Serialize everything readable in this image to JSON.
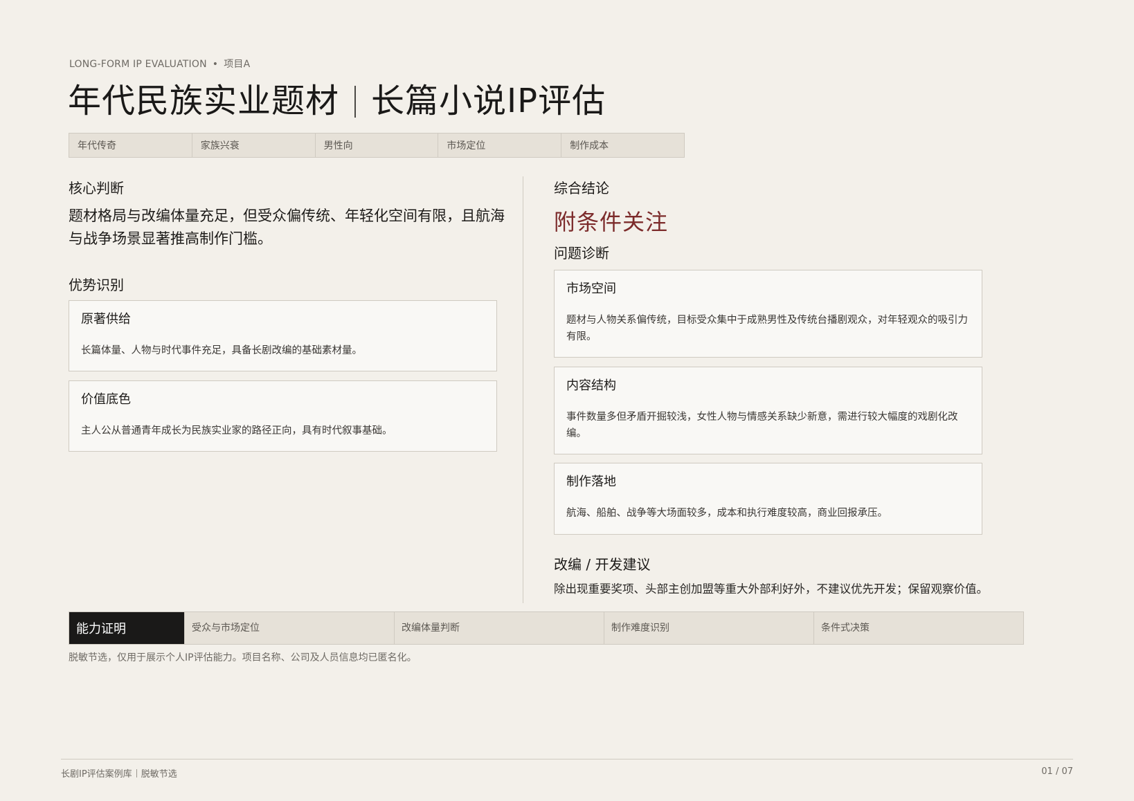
{
  "header": {
    "eyebrow_label": "LONG-FORM IP EVALUATION",
    "eyebrow_sep": "•",
    "eyebrow_project": "项目A",
    "title_left": "年代民族实业题材",
    "title_right": "长篇小说IP评估"
  },
  "tags": [
    "年代传奇",
    "家族兴衰",
    "男性向",
    "市场定位",
    "制作成本"
  ],
  "left": {
    "core_heading": "核心判断",
    "core_text": "题材格局与改编体量充足，但受众偏传统、年轻化空间有限，且航海与战争场景显著推高制作门槛。",
    "strength_heading": "优势识别",
    "strengths": [
      {
        "title": "原著供给",
        "text": "长篇体量、人物与时代事件充足，具备长剧改编的基础素材量。"
      },
      {
        "title": "价值底色",
        "text": "主人公从普通青年成长为民族实业家的路径正向，具有时代叙事基础。"
      }
    ]
  },
  "right": {
    "conclusion_heading": "综合结论",
    "verdict": "附条件关注",
    "diagnosis_heading": "问题诊断",
    "issues": [
      {
        "title": "市场空间",
        "text": "题材与人物关系偏传统，目标受众集中于成熟男性及传统台播剧观众，对年轻观众的吸引力有限。"
      },
      {
        "title": "内容结构",
        "text": "事件数量多但矛盾开掘较浅，女性人物与情感关系缺少新意，需进行较大幅度的戏剧化改编。"
      },
      {
        "title": "制作落地",
        "text": "航海、船舶、战争等大场面较多，成本和执行难度较高，商业回报承压。"
      }
    ],
    "advice_heading": "改编 / 开发建议",
    "advice_text": "除出现重要奖项、头部主创加盟等重大外部利好外，不建议优先开发；保留观察价值。"
  },
  "ability": {
    "heading": "能力证明",
    "items": [
      "受众与市场定位",
      "改编体量判断",
      "制作难度识别",
      "条件式决策"
    ]
  },
  "disclaimer": "脱敏节选，仅用于展示个人IP评估能力。项目名称、公司及人员信息均已匿名化。",
  "footer": {
    "left_a": "长剧IP评估案例库",
    "left_b": "脱敏节选",
    "page": "01 / 07"
  },
  "colors": {
    "background": "#f3f0ea",
    "verdict": "#7c2b2b",
    "tag_bg": "#e6e1d8",
    "card_bg": "#f9f8f5",
    "ability_head_bg": "#1a1918"
  }
}
